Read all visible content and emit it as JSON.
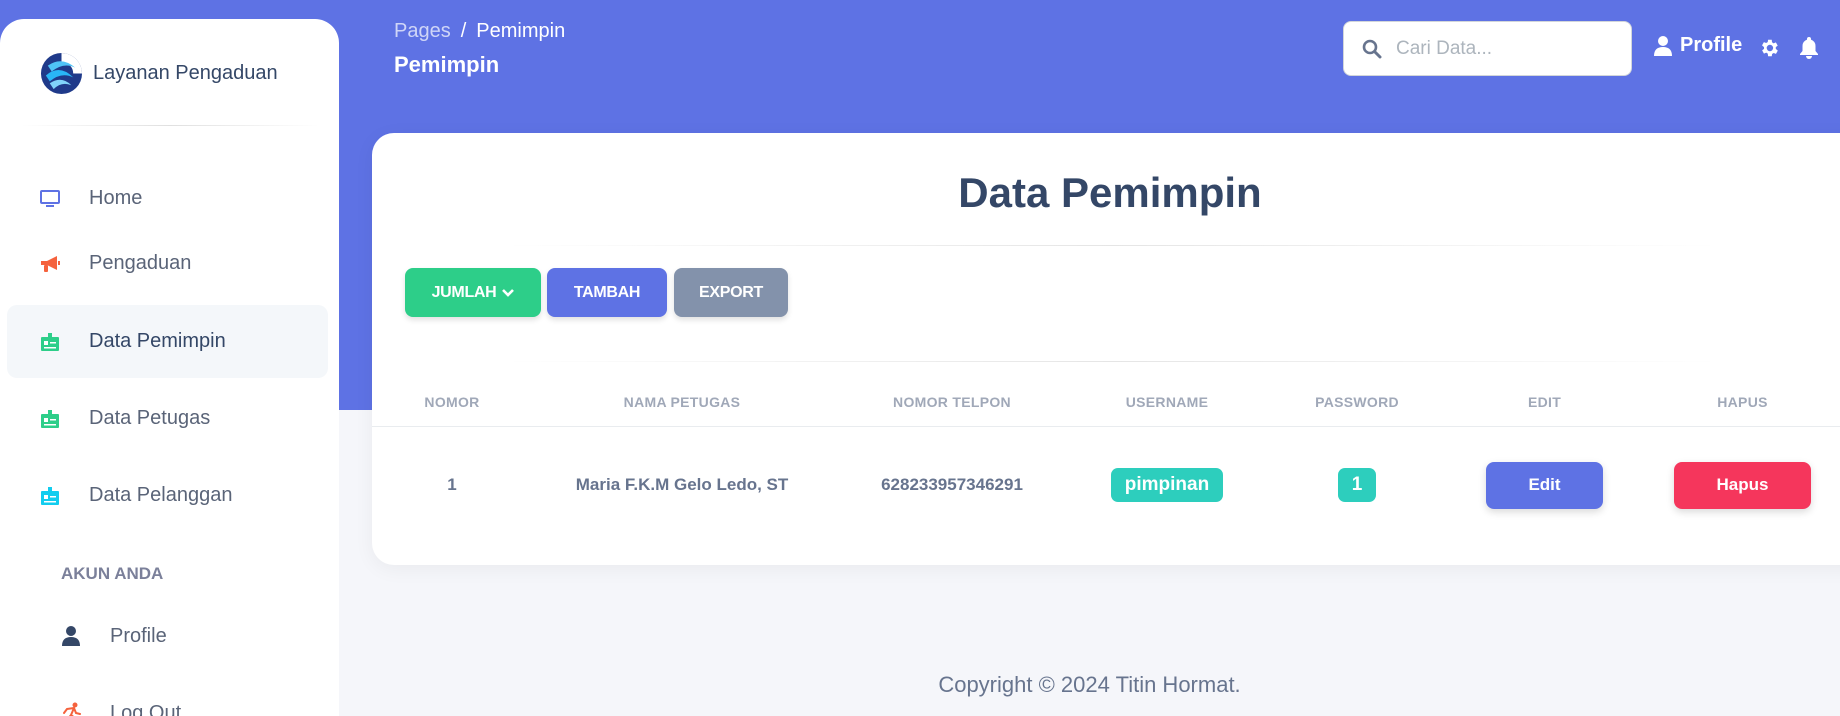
{
  "sidebar": {
    "brand": "Layanan Pengaduan",
    "items": [
      {
        "label": "Home",
        "icon": "monitor-icon"
      },
      {
        "label": "Pengaduan",
        "icon": "megaphone-icon"
      },
      {
        "label": "Data Pemimpin",
        "icon": "id-card-icon"
      },
      {
        "label": "Data Petugas",
        "icon": "id-card-icon"
      },
      {
        "label": "Data Pelanggan",
        "icon": "id-card-icon"
      }
    ],
    "section_title": "AKUN ANDA",
    "account_items": [
      {
        "label": "Profile",
        "icon": "user-icon"
      },
      {
        "label": "Log Out",
        "icon": "running-icon"
      }
    ]
  },
  "header": {
    "breadcrumb_root": "Pages",
    "breadcrumb_sep": "/",
    "breadcrumb_current": "Pemimpin",
    "page_title": "Pemimpin",
    "search_placeholder": "Cari Data...",
    "profile_label": "Profile"
  },
  "card": {
    "title": "Data Pemimpin",
    "buttons": {
      "jumlah": "JUMLAH",
      "tambah": "TAMBAH",
      "export": "EXPORT"
    },
    "table": {
      "headers": [
        "NOMOR",
        "NAMA PETUGAS",
        "NOMOR TELPON",
        "USERNAME",
        "PASSWORD",
        "EDIT",
        "HAPUS"
      ],
      "rows": [
        {
          "nomor": "1",
          "nama": "Maria F.K.M Gelo Ledo, ST",
          "telpon": "628233957346291",
          "username": "pimpinan",
          "password": "1",
          "edit": "Edit",
          "hapus": "Hapus"
        }
      ]
    }
  },
  "footer": {
    "copyright": "Copyright © 2024 Titin Hormat."
  },
  "colors": {
    "primary": "#5e72e4",
    "success": "#2dce89",
    "secondary": "#8392ab",
    "danger": "#f5365c",
    "teal": "#2dcebd"
  }
}
